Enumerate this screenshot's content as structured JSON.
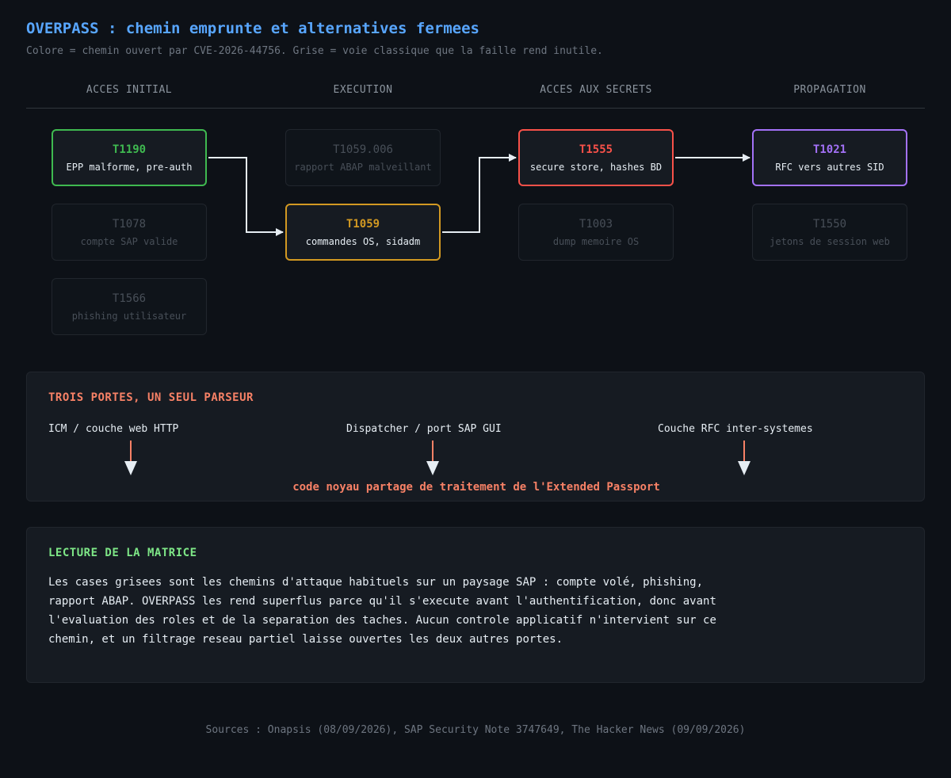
{
  "header": {
    "title": "OVERPASS : chemin emprunte et alternatives fermees",
    "subtitle": "Colore = chemin ouvert par CVE-2026-44756. Grise = voie classique que la faille rend inutile."
  },
  "columns": [
    "ACCES INITIAL",
    "EXECUTION",
    "ACCES AUX SECRETS",
    "PROPAGATION"
  ],
  "matrix": {
    "initial": [
      {
        "code": "T1190",
        "desc": "EPP malforme, pre-auth",
        "state": "active"
      },
      {
        "code": "T1078",
        "desc": "compte SAP valide",
        "state": "inactive"
      },
      {
        "code": "T1566",
        "desc": "phishing utilisateur",
        "state": "inactive"
      }
    ],
    "execution": [
      {
        "code": "T1059.006",
        "desc": "rapport ABAP malveillant",
        "state": "inactive"
      },
      {
        "code": "T1059",
        "desc": "commandes OS, sidadm",
        "state": "active"
      }
    ],
    "secrets": [
      {
        "code": "T1555",
        "desc": "secure store, hashes BD",
        "state": "active"
      },
      {
        "code": "T1003",
        "desc": "dump memoire OS",
        "state": "inactive"
      }
    ],
    "propagation": [
      {
        "code": "T1021",
        "desc": "RFC vers autres SID",
        "state": "active"
      },
      {
        "code": "T1550",
        "desc": "jetons de session web",
        "state": "inactive"
      }
    ]
  },
  "colors": {
    "initial": "#3fb950",
    "execution": "#d29922",
    "secrets": "#f85149",
    "propagation": "#a371f7",
    "arrow": "#e6edf3",
    "gate_arrow": "#f78166"
  },
  "gates": {
    "title": "TROIS PORTES, UN SEUL PARSEUR",
    "items": [
      "ICM / couche web HTTP",
      "Dispatcher / port SAP GUI",
      "Couche RFC inter-systemes"
    ],
    "core": "code noyau partage de traitement de l'Extended Passport"
  },
  "reading": {
    "title": "LECTURE DE LA MATRICE",
    "text": "Les cases grisees sont les chemins d'attaque habituels sur un paysage SAP : compte volé, phishing,\nrapport ABAP. OVERPASS les rend superflus parce qu'il s'execute avant l'authentification, donc avant\nl'evaluation des roles et de la separation des taches. Aucun controle applicatif n'intervient sur ce\nchemin, et un filtrage reseau partiel laisse ouvertes les deux autres portes."
  },
  "footer": {
    "sources": "Sources : Onapsis (08/09/2026), SAP Security Note 3747649, The Hacker News (09/09/2026)"
  }
}
